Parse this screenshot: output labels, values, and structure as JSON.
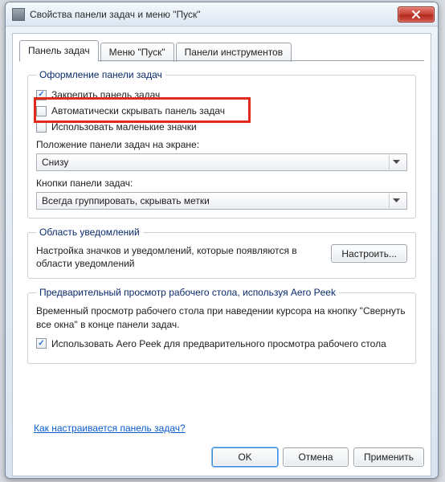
{
  "window": {
    "title": "Свойства панели задач и меню \"Пуск\""
  },
  "tabs": {
    "taskbar": "Панель задач",
    "start": "Меню \"Пуск\"",
    "toolbars": "Панели инструментов"
  },
  "appearance": {
    "legend": "Оформление панели задач",
    "lock": "Закрепить панель задач",
    "autohide": "Автоматически скрывать панель задач",
    "small_icons": "Использовать маленькие значки",
    "position_label": "Положение панели задач на экране:",
    "position_value": "Снизу",
    "buttons_label": "Кнопки панели задач:",
    "buttons_value": "Всегда группировать, скрывать метки"
  },
  "notify": {
    "legend": "Область уведомлений",
    "desc": "Настройка значков и уведомлений, которые появляются в области уведомлений",
    "button": "Настроить..."
  },
  "aero": {
    "legend": "Предварительный просмотр рабочего стола, используя Aero Peek",
    "desc": "Временный просмотр рабочего стола при наведении курсора на кнопку \"Свернуть все окна\" в конце панели задач.",
    "checkbox": "Использовать Aero Peek для предварительного просмотра рабочего стола"
  },
  "help_link": "Как настраивается панель задач?",
  "footer": {
    "ok": "OK",
    "cancel": "Отмена",
    "apply": "Применить"
  }
}
